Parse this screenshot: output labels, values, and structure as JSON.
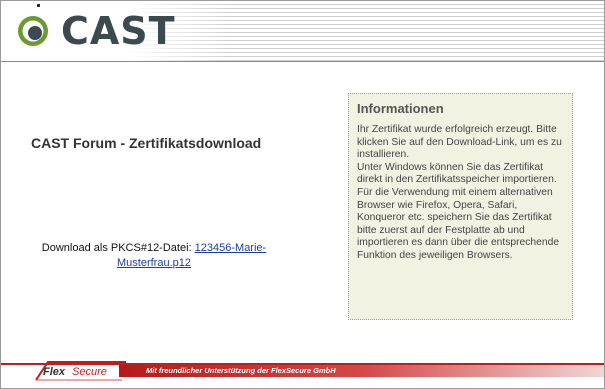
{
  "header": {
    "logo_text": "CAST"
  },
  "page": {
    "title": "CAST Forum - Zertifikatsdownload"
  },
  "download": {
    "label": "Download als PKCS#12-Datei:",
    "link_text": "123456-Marie-Musterfrau.p12"
  },
  "info": {
    "title": "Informationen",
    "paragraphs": [
      "Ihr Zertifikat wurde erfolgreich erzeugt. Bitte klicken Sie auf den Download-Link, um es zu installieren.",
      "Unter Windows können Sie das Zertifikat direkt in den Zertifikatsspeicher importieren.",
      "Für die Verwendung mit einem alternativen Browser wie Firefox, Opera, Safari, Konqueror etc. speichern Sie das Zertifikat bitte zuerst auf der Festplatte ab und importieren es dann über die entsprechende Funktion des jeweiligen Browsers."
    ]
  },
  "footer": {
    "logo_flex": "Flex",
    "logo_secure": "Secure",
    "text": "Mit freundlicher Unterstützung der FlexSecure GmbH"
  },
  "colors": {
    "logo_green": "#6b9a2e",
    "logo_grey": "#3a4a4e",
    "link_blue": "#1c3f9e",
    "footer_red": "#bf1e1e",
    "info_bg": "#f2f2e3"
  },
  "icons": {
    "logo_mark": "cast-logo-icon",
    "footer_mark": "flexsecure-swoosh-icon"
  }
}
